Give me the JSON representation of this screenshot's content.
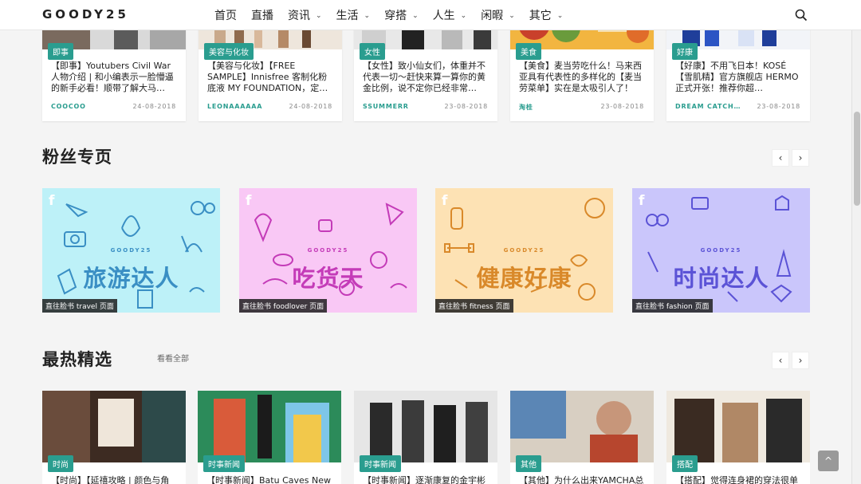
{
  "brand": {
    "logo": "GOODY25"
  },
  "nav": {
    "items": [
      {
        "label": "首页"
      },
      {
        "label": "直播"
      },
      {
        "label": "资讯",
        "dropdown": true
      },
      {
        "label": "生活",
        "dropdown": true
      },
      {
        "label": "穿搭",
        "dropdown": true
      },
      {
        "label": "人生",
        "dropdown": true
      },
      {
        "label": "闲暇",
        "dropdown": true
      },
      {
        "label": "其它",
        "dropdown": true
      }
    ],
    "search_icon": "search-icon"
  },
  "top_cards": [
    {
      "tag": "即事",
      "title": "【即事】Youtubers Civil War 人物介绍 | 和小编表示一脸懵逼的新手必看！顺带了解大马…",
      "author": "COOCOO",
      "date": "24-08-2018"
    },
    {
      "tag": "美容与化妆",
      "title": "【美容与化妆】【FREE SAMPLE】Innisfree 客制化粉底液 MY FOUNDATION，定…",
      "author": "LEONAAAAAA",
      "date": "24-08-2018"
    },
    {
      "tag": "女性",
      "title": "【女性】致小仙女们，体重并不代表一切～赶快来算一算你的黄金比例，说不定你已经非常…",
      "author": "SSUMMERR",
      "date": "23-08-2018"
    },
    {
      "tag": "美食",
      "title": "【美食】麦当劳吃什么！马来西亚具有代表性的多样化的【麦当劳菜单】实在是太吸引人了！",
      "author": "淘桂",
      "date": "23-08-2018"
    },
    {
      "tag": "好康",
      "title": "【好康】不用飞日本！KOSÉ【雪肌精】官方旗舰店 HERMO 正式开张！推荐你超…",
      "author": "DREAM CATCH…",
      "date": "23-08-2018"
    }
  ],
  "fans_section": {
    "title": "粉丝专页",
    "prev": "‹",
    "next": "›",
    "tiles": [
      {
        "headline": "旅游达人",
        "brand": "GOODY25",
        "caption": "直往脸书 travel 页面",
        "bg": "#bdf1f8",
        "fg": "#3a8fc4",
        "fb": "f"
      },
      {
        "headline": "吃货天",
        "brand": "GOODY25",
        "caption": "直往脸书 foodlover 页面",
        "bg": "#f9c8f5",
        "fg": "#c43bb8",
        "fb": "f"
      },
      {
        "headline": "健康好康",
        "brand": "GOODY25",
        "caption": "直往脸书 fitness 页面",
        "bg": "#fde2b4",
        "fg": "#d9892a",
        "fb": "f"
      },
      {
        "headline": "时尚达人",
        "brand": "GOODY25",
        "caption": "直往脸书 fashion 页面",
        "bg": "#cac6fb",
        "fg": "#5b53d6",
        "fb": "f"
      }
    ]
  },
  "hot_section": {
    "title": "最热精选",
    "see_all": "看看全部",
    "prev": "‹",
    "next": "›",
    "cards": [
      {
        "tag": "时尚",
        "title": "【时尚】【延禧攻略 | 颜色与角"
      },
      {
        "tag": "时事新闻",
        "title": "【时事新闻】Batu Caves New"
      },
      {
        "tag": "时事新闻",
        "title": "【时事新闻】逐渐康复的金宇彬"
      },
      {
        "tag": "其他",
        "title": "【其他】为什么出来YAMCHA总"
      },
      {
        "tag": "搭配",
        "title": "【搭配】觉得连身裙的穿法很单"
      }
    ]
  },
  "back_to_top": "^"
}
